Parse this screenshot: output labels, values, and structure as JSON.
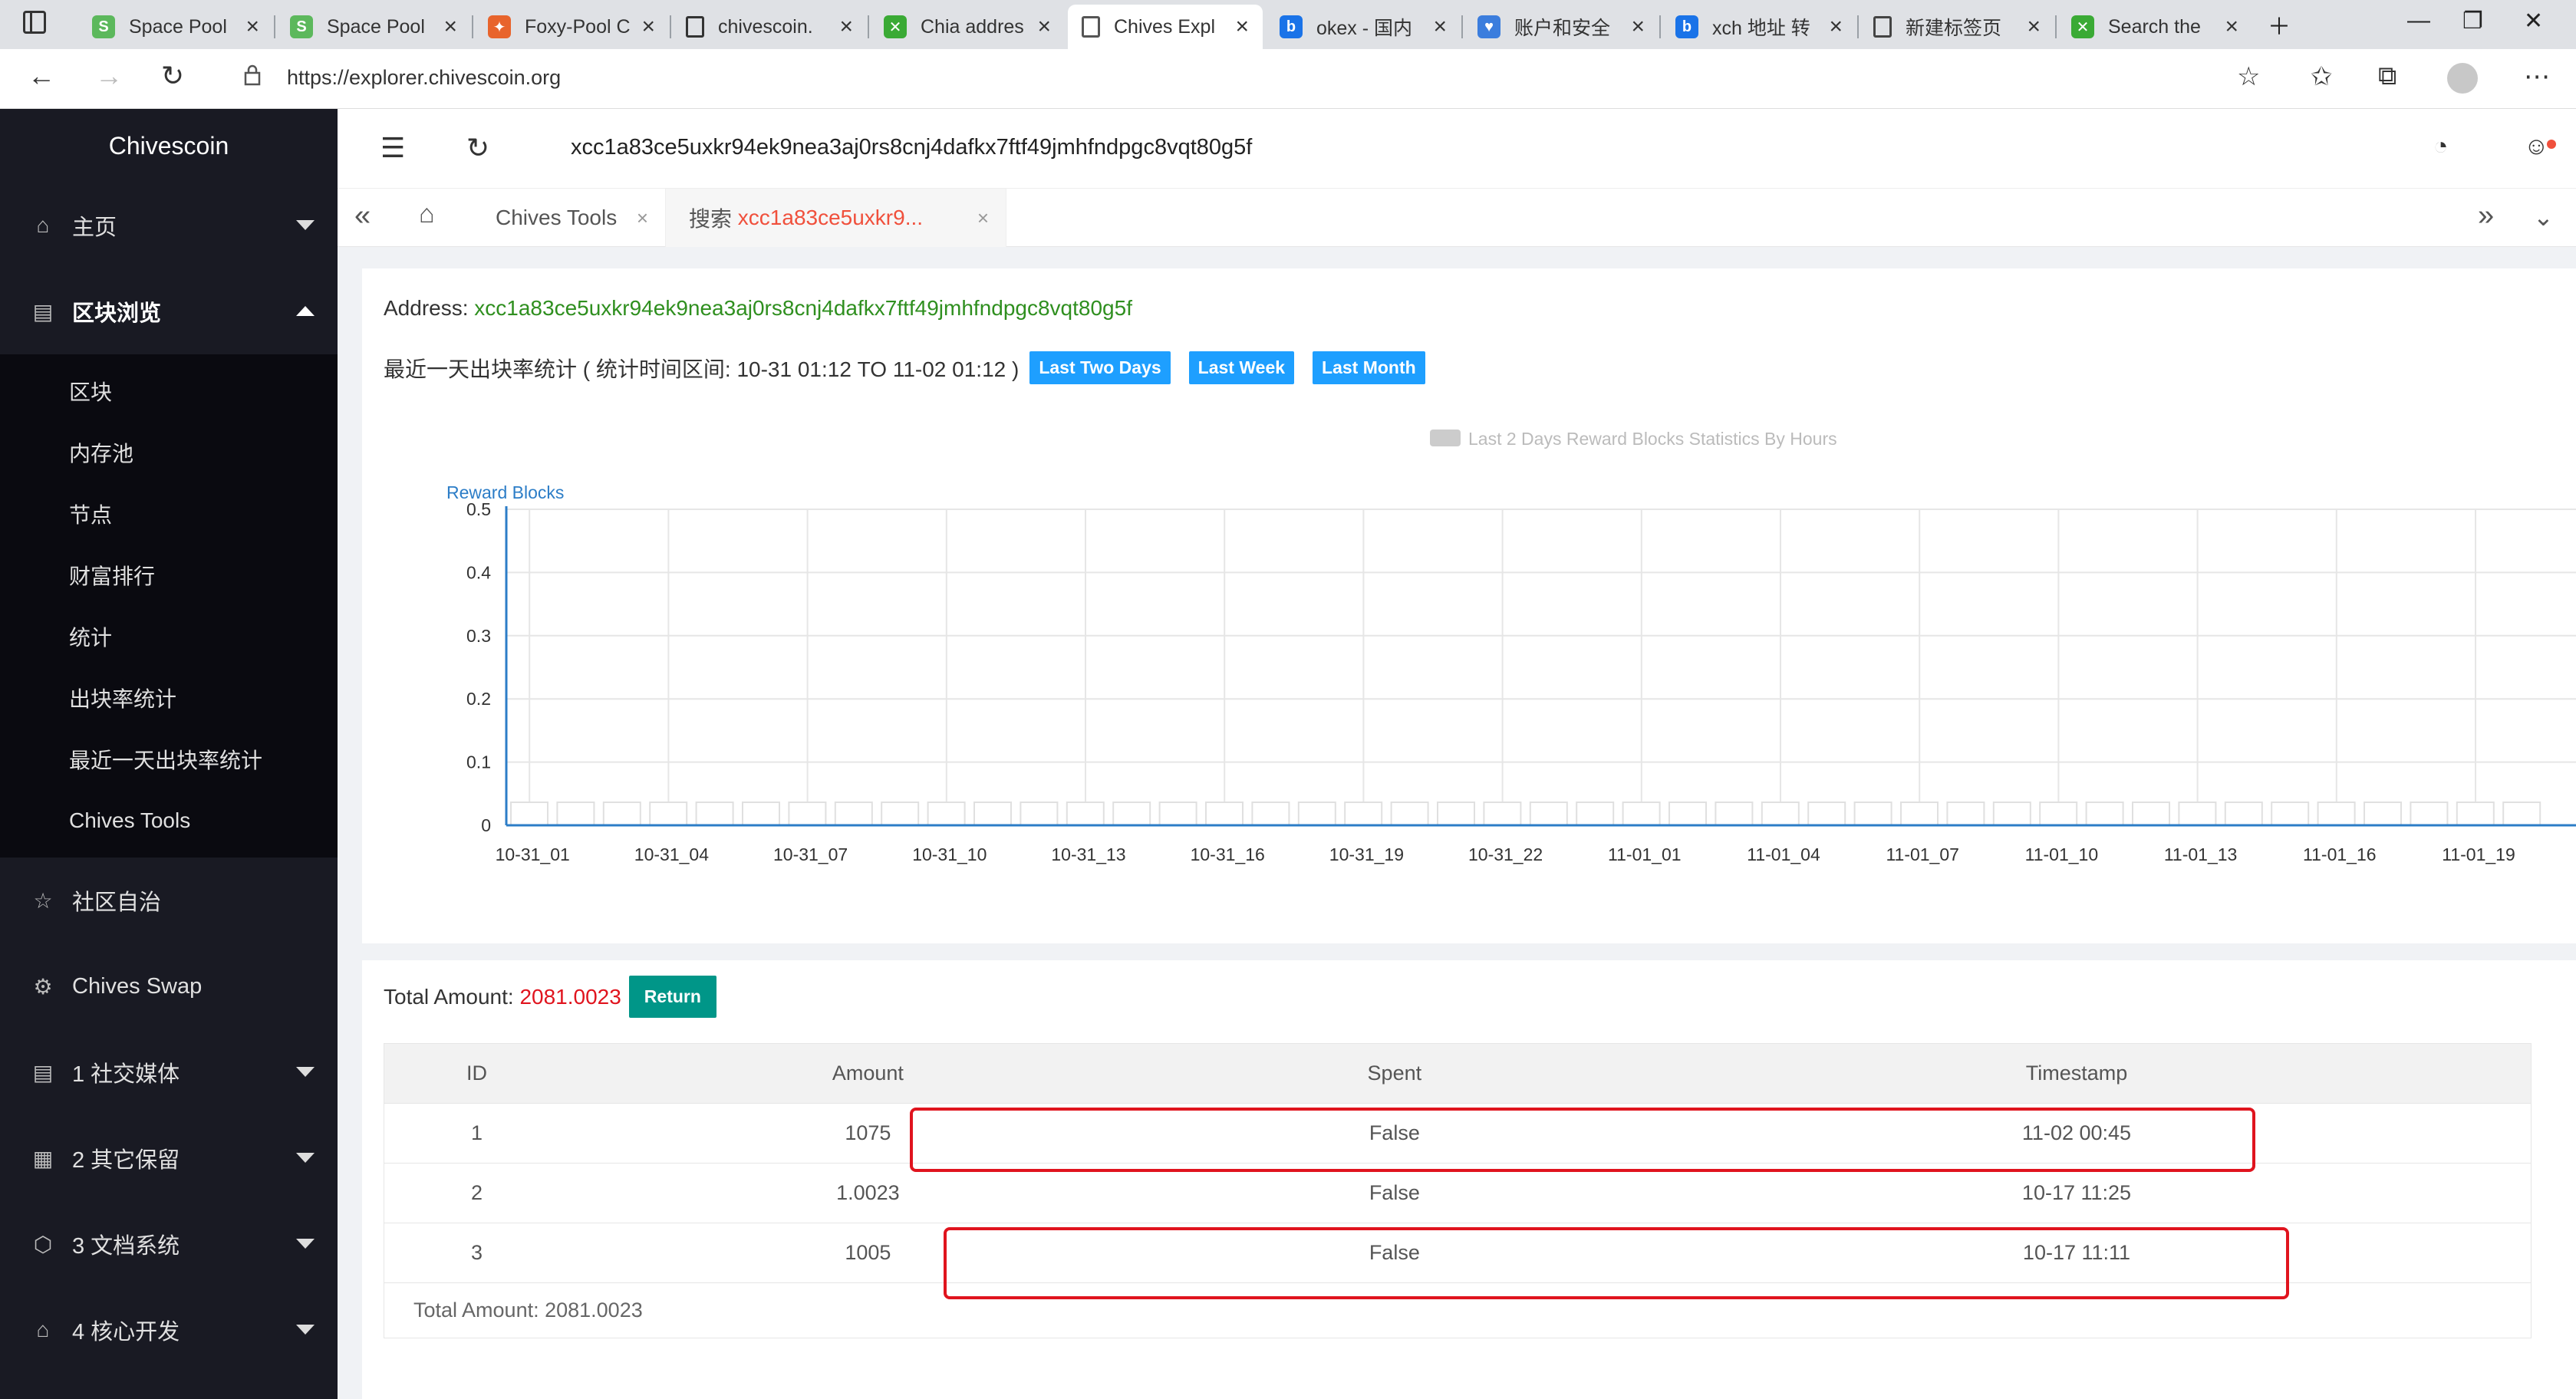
{
  "browser": {
    "tabs": [
      {
        "label": "Space Pool",
        "icon": "s-icon",
        "color": "#5cb85c"
      },
      {
        "label": "Space Pool",
        "icon": "s-icon",
        "color": "#5cb85c"
      },
      {
        "label": "Foxy-Pool C",
        "icon": "fox-icon",
        "color": "#e8642c"
      },
      {
        "label": "chivescoin.",
        "icon": "chives-icon",
        "color": "#333333"
      },
      {
        "label": "Chia addres",
        "icon": "chia-icon",
        "color": "#3aaa35"
      },
      {
        "label": "Chives Expl",
        "icon": "page-icon",
        "color": "#555555",
        "active": true
      },
      {
        "label": "okex - 国内",
        "icon": "bing-icon",
        "color": "#1a73e8"
      },
      {
        "label": "账户和安全",
        "icon": "heart-icon",
        "color": "#3b7ddd"
      },
      {
        "label": "xch 地址 转",
        "icon": "bing-icon",
        "color": "#1a73e8"
      },
      {
        "label": "新建标签页",
        "icon": "newtab-icon",
        "color": "#444444"
      },
      {
        "label": "Search the",
        "icon": "chia-icon",
        "color": "#3aaa35"
      }
    ],
    "url": "https://explorer.chivescoin.org"
  },
  "sidebar": {
    "logo": "Chivescoin",
    "items": [
      {
        "label": "主页",
        "icon": "home-icon",
        "arrow": "down"
      },
      {
        "label": "区块浏览",
        "icon": "list-icon",
        "arrow": "up",
        "open": true,
        "sub": [
          "区块",
          "内存池",
          "节点",
          "财富排行",
          "统计",
          "出块率统计",
          "最近一天出块率统计",
          "Chives Tools"
        ]
      },
      {
        "label": "社区自治",
        "icon": "star-icon"
      },
      {
        "label": "Chives Swap",
        "icon": "gear-icon"
      },
      {
        "label": "1 社交媒体",
        "icon": "list-icon",
        "arrow": "down"
      },
      {
        "label": "2 其它保留",
        "icon": "grid-icon",
        "arrow": "down"
      },
      {
        "label": "3 文档系统",
        "icon": "cube-icon",
        "arrow": "down"
      },
      {
        "label": "4 核心开发",
        "icon": "home-icon",
        "arrow": "down"
      }
    ]
  },
  "header": {
    "address": "xcc1a83ce5uxkr94ek9nea3aj0rs8cnj4dafkx7ftf49jmhfndpgc8vqt80g5f"
  },
  "pagetabs": [
    {
      "label": "Chives Tools"
    },
    {
      "prefix": "搜索",
      "value": "xcc1a83ce5uxkr9..."
    }
  ],
  "content": {
    "address_label": "Address:",
    "address": "xcc1a83ce5uxkr94ek9nea3aj0rs8cnj4dafkx7ftf49jmhfndpgc8vqt80g5f",
    "stat_label": "最近一天出块率统计 ( 统计时间区间: 10-31 01:12 TO 11-02 01:12 )",
    "buttons": [
      "Last Two Days",
      "Last Week",
      "Last Month"
    ]
  },
  "chart_data": {
    "type": "bar",
    "title": "",
    "legend": "Last 2 Days Reward Blocks Statistics By Hours",
    "ylabel": "Reward Blocks",
    "ylim": [
      0,
      0.5
    ],
    "yticks": [
      0,
      0.1,
      0.2,
      0.3,
      0.4,
      0.5
    ],
    "xticks": [
      "10-31_01",
      "10-31_04",
      "10-31_07",
      "10-31_10",
      "10-31_13",
      "10-31_16",
      "10-31_19",
      "10-31_22",
      "11-01_01",
      "11-01_04",
      "11-01_07",
      "11-01_10",
      "11-01_13",
      "11-01_16",
      "11-01_19"
    ],
    "values": [
      0,
      0,
      0,
      0,
      0,
      0,
      0,
      0,
      0,
      0,
      0,
      0,
      0,
      0,
      0,
      0,
      0,
      0,
      0,
      0,
      0,
      0,
      0,
      0,
      0,
      0,
      0,
      0,
      0,
      0,
      0,
      0,
      0,
      0,
      0,
      0,
      0,
      0,
      0,
      0,
      0,
      0,
      0,
      0,
      0
    ]
  },
  "transactions": {
    "total_label": "Total Amount:",
    "total_value": "2081.0023",
    "return_label": "Return",
    "columns": [
      "ID",
      "Amount",
      "Spent",
      "Timestamp"
    ],
    "rows": [
      [
        "1",
        "1075",
        "False",
        "11-02 00:45"
      ],
      [
        "2",
        "1.0023",
        "False",
        "10-17 11:25"
      ],
      [
        "3",
        "1005",
        "False",
        "10-17 11:11"
      ]
    ],
    "footer": "Total Amount: 2081.0023"
  }
}
